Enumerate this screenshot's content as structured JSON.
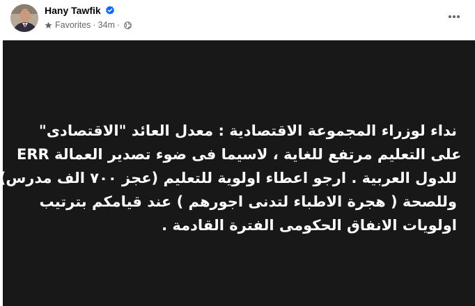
{
  "post": {
    "author": {
      "name": "Hany Tawfik",
      "verified": true
    },
    "meta": {
      "audience_label": "Favorites",
      "separator": "·",
      "timestamp": "34m",
      "icons": [
        "star-icon",
        "globe-icon"
      ]
    },
    "menu": {
      "icon": "more-horizontal-icon"
    },
    "body": {
      "background_color": "#181818",
      "text_color": "#ffffff",
      "lines": [
        "نداء لوزراء المجموعة الاقتصادية : معدل العائد \"الاقتصادى\"",
        "ERR على التعليم مرتفع للغاية ، لاسيما فى ضوء تصدير العمالة",
        "للدول العربية . ارجو اعطاء اولوية للتعليم (عجز ٧٠٠ الف مدرس)",
        "وللصحة ( هجرة الاطباء لتدنى اجورهم ) عند قيامكم بترتيب",
        "اولويات الانفاق الحكومى الفترة القادمة ."
      ]
    }
  },
  "colors": {
    "name_text": "#050505",
    "meta_text": "#65676b",
    "verified_badge": "#0866ff"
  }
}
